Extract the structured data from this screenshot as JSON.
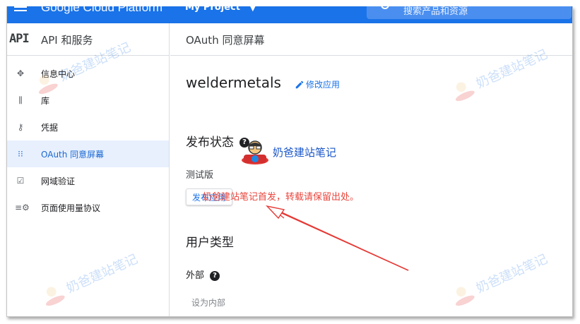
{
  "topbar": {
    "brand": "Google Cloud Platform",
    "project": "My Project",
    "search_placeholder": "搜索产品和资源"
  },
  "sidebar": {
    "logo": "API",
    "title": "API 和服务",
    "items": [
      {
        "label": "信息中心",
        "icon": "dashboard-icon",
        "glyph": "✥"
      },
      {
        "label": "库",
        "icon": "library-icon",
        "glyph": "⫼"
      },
      {
        "label": "凭据",
        "icon": "key-icon",
        "glyph": "⚷"
      },
      {
        "label": "OAuth 同意屏幕",
        "icon": "consent-icon",
        "glyph": "⁝⁝",
        "active": true
      },
      {
        "label": "网域验证",
        "icon": "checkbox-icon",
        "glyph": "☑"
      },
      {
        "label": "页面使用量协议",
        "icon": "settings-list-icon",
        "glyph": "≡⚙"
      }
    ]
  },
  "main": {
    "page_title": "OAuth 同意屏幕",
    "app_name": "weldermetals",
    "edit_label": "修改应用",
    "publish_section": "发布状态",
    "publish_status": "测试版",
    "publish_button": "发布应用",
    "user_type_section": "用户类型",
    "user_type": "外部",
    "set_internal": "设为内部"
  },
  "annotations": {
    "note": "奶爸建站笔记首发，转载请保留出处。",
    "watermark": "奶爸建站笔记",
    "note_color": "#e8453c"
  },
  "colors": {
    "accent": "#1a73e8",
    "active_bg": "#e8f0fe"
  }
}
